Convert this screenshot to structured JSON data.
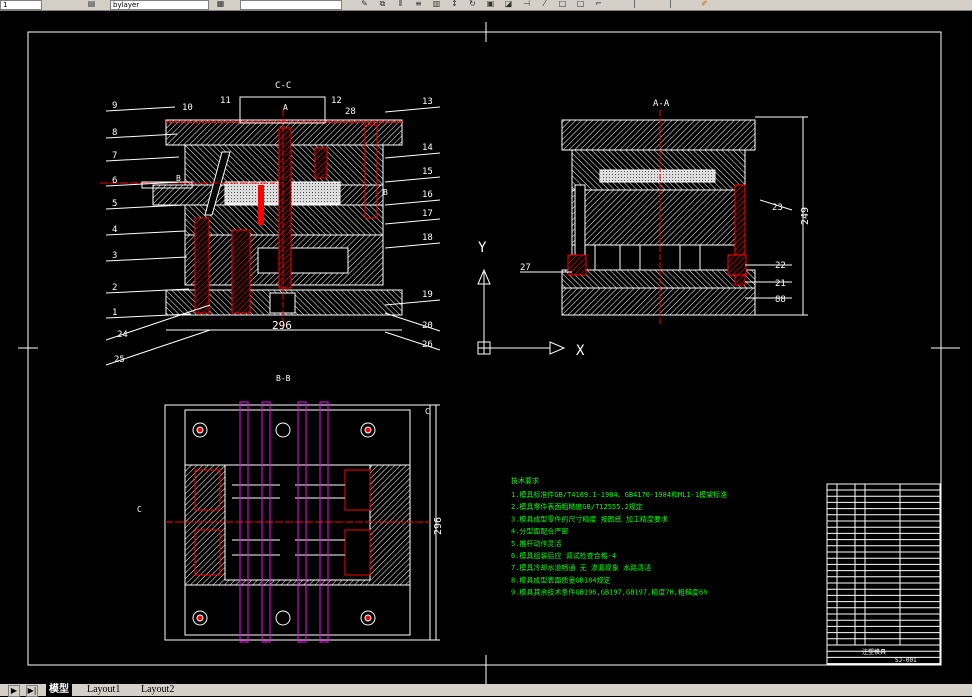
{
  "toolbar": {
    "field1": "1",
    "field2": "bylayer",
    "field3": ""
  },
  "tabs": [
    {
      "label": "模型"
    },
    {
      "label": "Layout1"
    },
    {
      "label": "Layout2"
    }
  ],
  "views": {
    "cc": {
      "title": "C-C",
      "dim": "296",
      "section_a": "A",
      "section_b": "B",
      "section_b2": "B",
      "labels_left": [
        "9",
        "8",
        "7",
        "6",
        "5",
        "4",
        "3",
        "2",
        "1",
        "24",
        "25"
      ],
      "labels_right": [
        "13",
        "14",
        "15",
        "16",
        "17",
        "18",
        "19",
        "20",
        "26"
      ],
      "labels_top": [
        "10",
        "11",
        "12",
        "28"
      ]
    },
    "aa": {
      "title": "A-A",
      "dim": "249",
      "labels": [
        "23",
        "22",
        "21",
        "88",
        "27"
      ]
    },
    "bb": {
      "title": "B-B",
      "dim": "296",
      "section_c": "C"
    },
    "axis": {
      "x": "X",
      "y": "Y"
    }
  },
  "notes": {
    "title": "技术要求",
    "items": [
      "1.模具标准件GB/T4169.1-1984、GB4170-1984和ML1-1模架标准",
      "2.模具零件表面粗糙度GB/T12555.2规定",
      "3.模具成型零件的尺寸精度 按图纸 加工精度要求",
      "4.分型面配合严密",
      "5.推杆动作灵活",
      "6.模具组装后应 调试检查合格-4",
      "7.模具冷却水道畅通 无 渗漏现象 水路清洁",
      "8.模具成型表面质量GB184规定",
      "9.模具其余技术条件GB196,GB197,GB197,精度7H,粗糙度6h"
    ]
  },
  "title_block": {
    "drawing_name": "注塑模具",
    "code": "SJ-001"
  },
  "colors": {
    "frame": "#ffffff",
    "section": "#ff0000",
    "text_green": "#00ff00",
    "magenta": "#ff00ff",
    "canvas": "#000000"
  }
}
